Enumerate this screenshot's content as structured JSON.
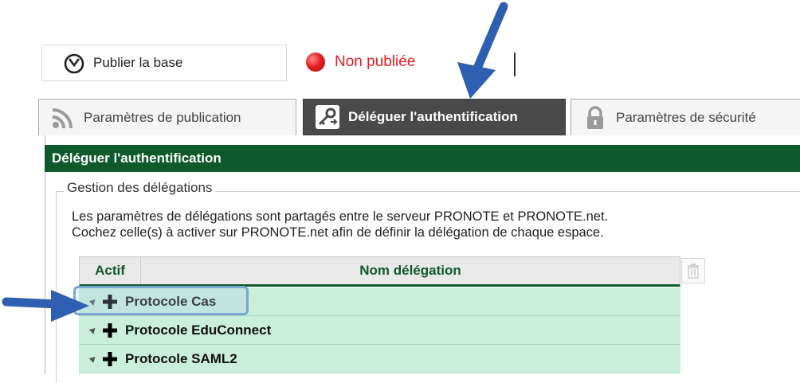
{
  "toolbar": {
    "publish_label": "Publier la base",
    "status_text": "Non publiée"
  },
  "tabs": [
    {
      "label": "Paramètres de publication",
      "active": false
    },
    {
      "label": "Déléguer l'authentification",
      "active": true
    },
    {
      "label": "Paramètres de sécurité",
      "active": false
    }
  ],
  "panel": {
    "header": "Déléguer l'authentification",
    "legend": "Gestion des délégations",
    "description_line1": "Les paramètres de délégations sont partagés entre le serveur PRONOTE et PRONOTE.net.",
    "description_line2": "Cochez celle(s) à activer sur PRONOTE.net afin de définir la délégation de chaque espace."
  },
  "table": {
    "columns": [
      "Actif",
      "Nom délégation"
    ],
    "rows": [
      {
        "name": "Protocole Cas"
      },
      {
        "name": "Protocole EduConnect"
      },
      {
        "name": "Protocole SAML2"
      }
    ]
  },
  "colors": {
    "header_green": "#0f5a2c",
    "row_green": "#c9eedb",
    "status_red": "#e0211f",
    "arrow_blue": "#2f5fb0"
  }
}
